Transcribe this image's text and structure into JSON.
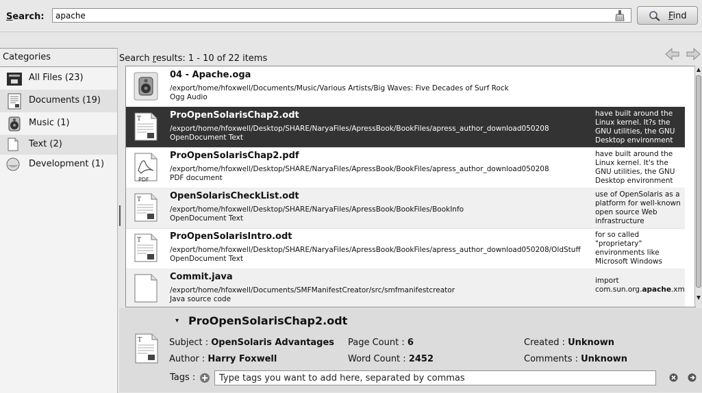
{
  "search": {
    "label_prefix": "S",
    "label_rest": "earch:",
    "value": "apache",
    "find_prefix": "F",
    "find_rest": "ind"
  },
  "sidebar": {
    "header": "Categories",
    "items": [
      {
        "label": "All Files (23)",
        "icon": "all-files-icon"
      },
      {
        "label": "Documents (19)",
        "icon": "documents-icon"
      },
      {
        "label": "Music (1)",
        "icon": "music-icon"
      },
      {
        "label": "Text (2)",
        "icon": "text-icon"
      },
      {
        "label": "Development (1)",
        "icon": "development-icon"
      }
    ]
  },
  "results": {
    "header_prefix": "Search ",
    "header_ul": "r",
    "header_rest": "esults: 1 - 10 of 22 items",
    "items": [
      {
        "title": "04 - Apache.oga",
        "path": "/export/home/hfoxwell/Documents/Music/Various Artists/Big Waves: Five Decades of Surf Rock",
        "type": "Ogg Audio",
        "snippet": "",
        "icon": "audio-file-icon"
      },
      {
        "title": "ProOpenSolarisChap2.odt",
        "path": "/export/home/hfoxwell/Desktop/SHARE/NaryaFiles/ApressBook/BookFiles/apress_author_download050208",
        "type": "OpenDocument Text",
        "snippet": "have built around the Linux kernel. It?s the GNU utilities, the GNU Desktop environment",
        "icon": "odt-file-icon"
      },
      {
        "title": "ProOpenSolarisChap2.pdf",
        "path": "/export/home/hfoxwell/Desktop/SHARE/NaryaFiles/ApressBook/BookFiles/apress_author_download050208",
        "type": "PDF document",
        "snippet": "have built around the Linux kernel. It's the GNU utilities, the GNU Desktop environment",
        "icon": "pdf-file-icon",
        "icon_caption": "PDF"
      },
      {
        "title": "OpenSolarisCheckList.odt",
        "path": "/export/home/hfoxwell/Desktop/SHARE/NaryaFiles/ApressBook/BookFiles/BookInfo",
        "type": "OpenDocument Text",
        "snippet": "use of OpenSolaris as a platform for well-known open source Web infrastructure",
        "icon": "odt-file-icon"
      },
      {
        "title": "ProOpenSolarisIntro.odt",
        "path": "/export/home/hfoxwell/Desktop/SHARE/NaryaFiles/ApressBook/BookFiles/apress_author_download050208/OldStuff",
        "type": "OpenDocument Text",
        "snippet": "for so called \"proprietary\" environments like Microsoft Windows",
        "icon": "odt-file-icon"
      },
      {
        "title": "Commit.java",
        "path": "/export/home/hfoxwell/Documents/SMFManifestCreator/src/smfmanifestcreator",
        "type": "Java source code",
        "snippet_pre": "import com.sun.org.",
        "snippet_bold": "apache",
        "snippet_post": ".xml",
        "icon": "java-file-icon"
      }
    ]
  },
  "details": {
    "title": "ProOpenSolarisChap2.odt",
    "subject_label": "Subject : ",
    "subject_value": "OpenSolaris Advantages",
    "author_label": "Author : ",
    "author_value": "Harry Foxwell",
    "page_count_label": "Page Count : ",
    "page_count_value": "6",
    "word_count_label": "Word Count : ",
    "word_count_value": "2452",
    "created_label": "Created : ",
    "created_value": "Unknown",
    "comments_label": "Comments : ",
    "comments_value": "Unknown",
    "tags_label": "Tags :",
    "tags_placeholder": "Type tags you want to add here, separated by commas"
  }
}
